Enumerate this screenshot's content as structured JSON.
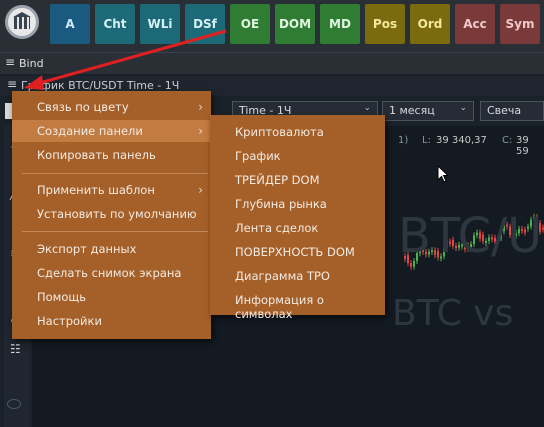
{
  "toolbar": {
    "buttons": [
      {
        "label": "A",
        "bg": "#1a5a80",
        "fg": "#cfe8ff"
      },
      {
        "label": "Cht",
        "bg": "#1c6a78",
        "fg": "#d6f0f4"
      },
      {
        "label": "WLi",
        "bg": "#1c6a78",
        "fg": "#d6f0f4"
      },
      {
        "label": "DSf",
        "bg": "#1c6a78",
        "fg": "#d6f0f4"
      },
      {
        "label": "OE",
        "bg": "#2e7d32",
        "fg": "#e2f5e2"
      },
      {
        "label": "DOM",
        "bg": "#2e7d32",
        "fg": "#e2f5e2"
      },
      {
        "label": "MD",
        "bg": "#2e7d32",
        "fg": "#e2f5e2"
      },
      {
        "label": "Pos",
        "bg": "#7a6a10",
        "fg": "#f2ea9a"
      },
      {
        "label": "Ord",
        "bg": "#7a6a10",
        "fg": "#f2ea9a"
      },
      {
        "label": "Acc",
        "bg": "#7a3a3a",
        "fg": "#f0c8c8"
      },
      {
        "label": "Sym",
        "bg": "#7a3a3a",
        "fg": "#f0c8c8"
      }
    ]
  },
  "bind": {
    "label": "Bind"
  },
  "chart_window": {
    "title": "График BTC/USDT Time - 1Ч",
    "timeframe": "Time - 1Ч",
    "period": "1 месяц",
    "style": "Свеча",
    "ohlc_prefix": "1)",
    "low_label": "L:",
    "low_value": "39 340,37",
    "close_label": "C:",
    "close_value": "39 59",
    "watermark_symbol": "BTC/U",
    "watermark_sub": "BTC vs"
  },
  "context_menu": {
    "items": [
      {
        "label": "Связь по цвету",
        "has_submenu": true
      },
      {
        "label": "Создание панели",
        "has_submenu": true,
        "active": true
      },
      {
        "label": "Копировать панель",
        "has_submenu": false
      },
      {
        "label": "Применить шаблон",
        "has_submenu": true
      },
      {
        "label": "Установить по умолчанию",
        "has_submenu": false
      },
      {
        "label": "Экспорт данных",
        "has_submenu": false
      },
      {
        "label": "Сделать снимок экрана",
        "has_submenu": false
      },
      {
        "label": "Помощь",
        "has_submenu": false
      },
      {
        "label": "Настройки",
        "has_submenu": false
      }
    ],
    "submenu_arrow": "›"
  },
  "submenu": {
    "items": [
      "Криптовалюта",
      "График",
      "ТРЕЙДЕР DOM",
      "Глубина рынка",
      "Лента сделок",
      "ПОВЕРХНОСТЬ DOM",
      "Диаграмма TPO",
      "Информация о символах"
    ]
  },
  "icons": {
    "hamburger": "≡",
    "chevron": "⌄"
  },
  "colors": {
    "menu_bg": "#a5602a",
    "menu_active": "#c27c42",
    "arrow": "#e02020"
  }
}
